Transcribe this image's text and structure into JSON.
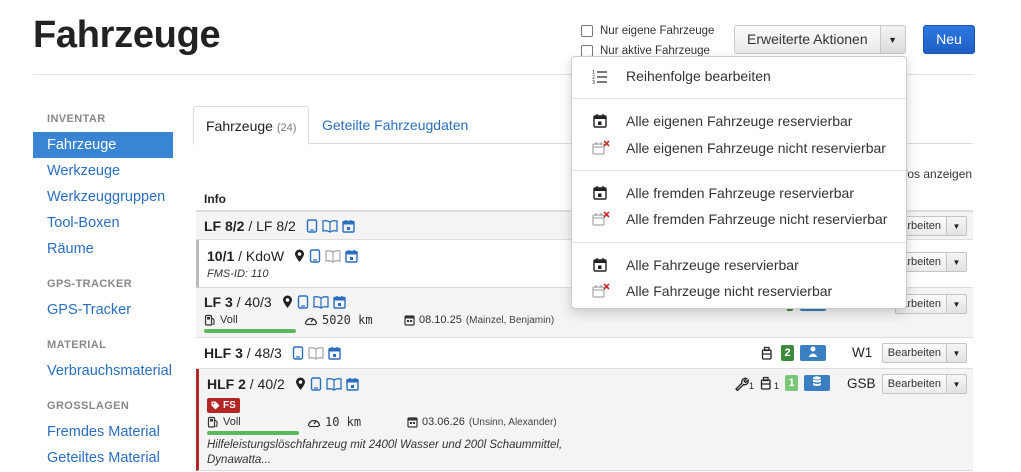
{
  "page": {
    "title": "Fahrzeuge"
  },
  "filters": {
    "own_label": "Nur eigene Fahrzeuge",
    "active_label": "Nur aktive Fahrzeuge"
  },
  "actions": {
    "extended_label": "Erweiterte Aktionen",
    "new_label": "Neu"
  },
  "sidebar": {
    "sections": [
      {
        "heading": "INVENTAR",
        "items": [
          "Fahrzeuge",
          "Werkzeuge",
          "Werkzeuggruppen",
          "Tool-Boxen",
          "Räume"
        ]
      },
      {
        "heading": "GPS-TRACKER",
        "items": [
          "GPS-Tracker"
        ]
      },
      {
        "heading": "MATERIAL",
        "items": [
          "Verbrauchsmaterial"
        ]
      },
      {
        "heading": "GROSSLAGEN",
        "items": [
          "Fremdes Material",
          "Geteiltes Material"
        ]
      }
    ],
    "active": "Fahrzeuge"
  },
  "tabs": [
    {
      "label": "Fahrzeuge",
      "count": "(24)"
    },
    {
      "label": "Geteilte Fahrzeugdaten"
    }
  ],
  "infos_toggle_tail": "fos anzeigen",
  "table": {
    "header": "Info",
    "edit_label": "Bearbeiten",
    "edit_label_clipped": "arbeiten",
    "rows": [
      {
        "name_bold": "LF 8/2",
        "name_rest": " / LF 8/2"
      },
      {
        "name_bold": "10/1",
        "name_rest": " / KdoW",
        "sub": "FMS-ID: 110"
      },
      {
        "name_bold": "LF 3",
        "name_rest": " / 40/3",
        "fuel": "Voll",
        "km": "5020 km",
        "date": "08.10.25",
        "date_person": "(Mainzel, Benjamin)"
      },
      {
        "name_bold": "HLF 3",
        "name_rest": " / 48/3",
        "count": "2",
        "code": "W1",
        "tool_sub": ""
      },
      {
        "name_bold": "HLF 2",
        "name_rest": " / 40/2",
        "count": "1",
        "code": "GSB",
        "wrench_sub": "1",
        "tool_sub": "1",
        "fs_label": "FS",
        "fuel": "Voll",
        "km": "10 km",
        "date": "03.06.26",
        "date_person": "(Unsinn, Alexander)",
        "description": "Hilfeleistungslöschfahrzeug mit 2400l Wasser und 200l Schaummittel, Dynawatta..."
      }
    ]
  },
  "dropdown": {
    "items": [
      {
        "label": "Reihenfolge bearbeiten",
        "icon": "list-order-icon"
      },
      {
        "label": "Alle eigenen Fahrzeuge reservierbar",
        "icon": "calendar-check-icon"
      },
      {
        "label": "Alle eigenen Fahrzeuge nicht reservierbar",
        "icon": "calendar-x-icon"
      },
      {
        "label": "Alle fremden Fahrzeuge reservierbar",
        "icon": "calendar-check-icon"
      },
      {
        "label": "Alle fremden Fahrzeuge nicht reservierbar",
        "icon": "calendar-x-icon"
      },
      {
        "label": "Alle Fahrzeuge reservierbar",
        "icon": "calendar-check-icon"
      },
      {
        "label": "Alle Fahrzeuge nicht reservierbar",
        "icon": "calendar-x-icon"
      }
    ]
  },
  "colors": {
    "link": "#2a6ebf",
    "primary": "#1f5fc4",
    "active_nav": "#3a85d3",
    "danger": "#b42626",
    "success": "#5cb85c"
  }
}
